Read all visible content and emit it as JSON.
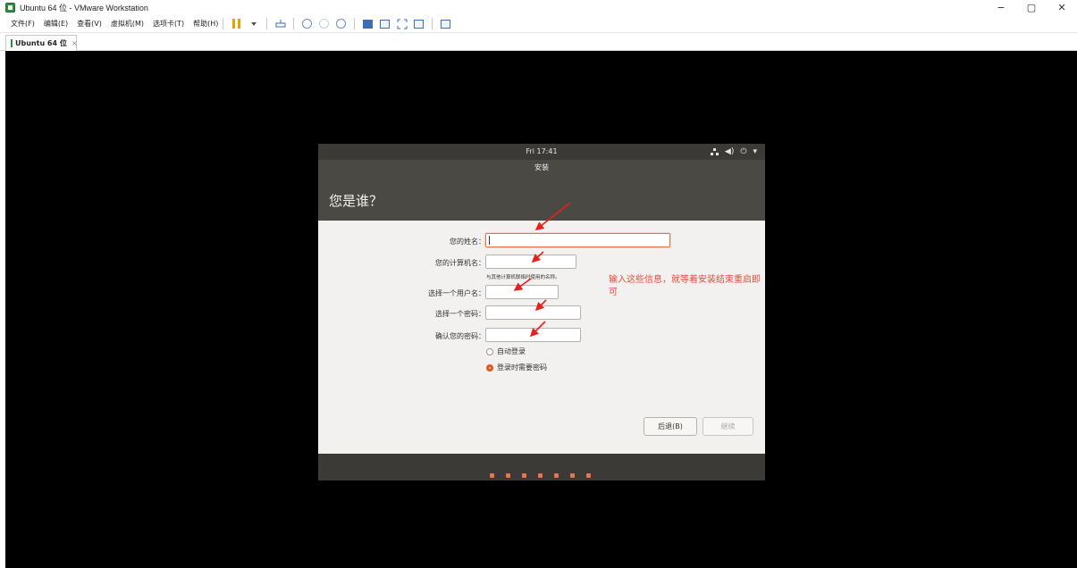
{
  "window": {
    "title": "Ubuntu 64 位 - VMware Workstation",
    "controls": [
      "−",
      "▢",
      "✕"
    ]
  },
  "menubar": {
    "items": [
      "文件(F)",
      "编辑(E)",
      "查看(V)",
      "虚拟机(M)",
      "选项卡(T)",
      "帮助(H)"
    ]
  },
  "tab": {
    "label": "Ubuntu 64 位",
    "close": "×"
  },
  "guest": {
    "topbar": {
      "clock": "Fri 17:41",
      "power": "⏻",
      "volume": "🔊",
      "menu_caret": "▾"
    },
    "header_title": "安装",
    "page_heading": "您是谁？",
    "form": {
      "name_label": "您的姓名：",
      "name_value": "",
      "computer_label": "您的计算机名：",
      "computer_value": "",
      "computer_hint": "与其他计算机联络时使用的名称。",
      "username_label": "选择一个用户名：",
      "username_value": "",
      "password_label": "选择一个密码：",
      "password_value": "",
      "confirm_label": "确认您的密码：",
      "confirm_value": ""
    },
    "login": {
      "auto_label": "自动登录",
      "auto_checked": false,
      "require_label": "登录时需要密码",
      "require_checked": true
    },
    "buttons": {
      "back": "后退(B)",
      "continue": "继续"
    },
    "progress": {
      "total_steps": 7
    }
  },
  "annotation": {
    "text": "输入这些信息，就等着安装结束重启即可",
    "color": "#e84a3c"
  },
  "colors": {
    "ubuntu_orange": "#e9541d",
    "ubuntu_dark": "#3b3a36",
    "ubuntu_header": "#4a4944"
  }
}
